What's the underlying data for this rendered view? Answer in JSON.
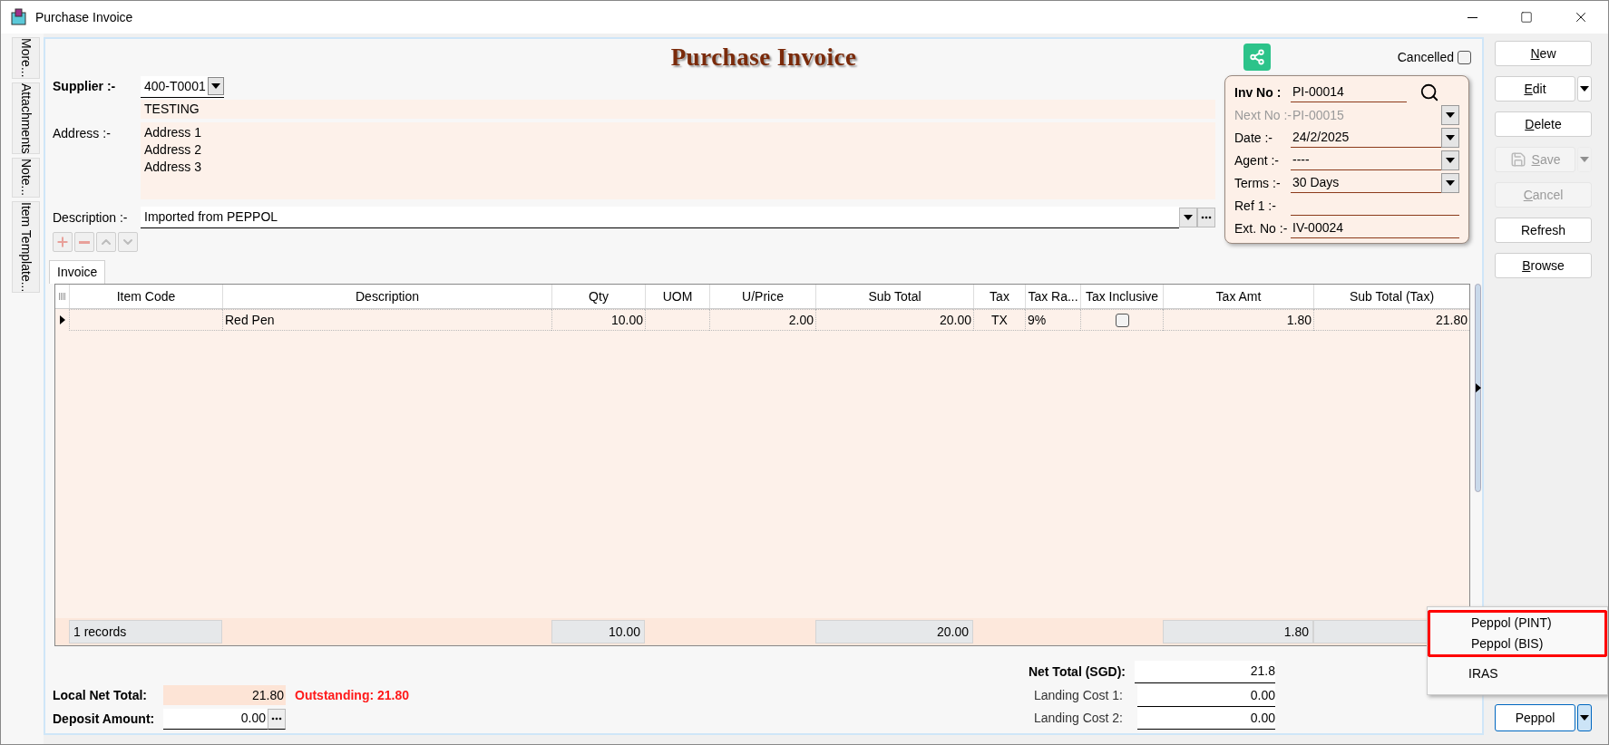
{
  "window": {
    "title": "Purchase Invoice"
  },
  "side_tabs": [
    {
      "label": "More..."
    },
    {
      "label": "Attachments"
    },
    {
      "label": "Note..."
    },
    {
      "label": "Item Template..."
    }
  ],
  "form": {
    "title": "Purchase Invoice",
    "cancelled": {
      "label": "Cancelled",
      "checked": false
    },
    "supplier": {
      "label": "Supplier :-",
      "code": "400-T0001",
      "name": "TESTING"
    },
    "address": {
      "label": "Address :-",
      "lines": [
        "Address 1",
        "Address 2",
        "Address 3"
      ]
    },
    "description": {
      "label": "Description :-",
      "value": "Imported from PEPPOL"
    },
    "header_fields": [
      {
        "label": "Inv No :",
        "value": "PI-00014",
        "kind": "key",
        "disabled": false
      },
      {
        "label": "Next No :-",
        "value": "PI-00015",
        "kind": "dropdown",
        "disabled": true
      },
      {
        "label": "Date :-",
        "value": "24/2/2025",
        "kind": "dropdown",
        "disabled": false
      },
      {
        "label": "Agent :-",
        "value": "----",
        "kind": "dropdown",
        "disabled": false
      },
      {
        "label": "Terms :-",
        "value": "30 Days",
        "kind": "dropdown",
        "disabled": false
      },
      {
        "label": "Ref 1 :-",
        "kind": "plain",
        "disabled": false
      },
      {
        "label": "Ext. No :-",
        "value": "IV-00024",
        "kind": "plain",
        "disabled": false
      }
    ]
  },
  "grid_tabs": [
    {
      "label": "Invoice",
      "selected": true
    }
  ],
  "table": {
    "columns": [
      {
        "label": "Item Code"
      },
      {
        "label": "Description"
      },
      {
        "label": "Qty"
      },
      {
        "label": "UOM"
      },
      {
        "label": "U/Price"
      },
      {
        "label": "Sub Total"
      },
      {
        "label": "Tax"
      },
      {
        "label": "Tax Ra..."
      },
      {
        "label": "Tax Inclusive"
      },
      {
        "label": "Tax Amt"
      },
      {
        "label": "Sub Total (Tax)"
      }
    ],
    "rows": [
      {
        "current": true,
        "cells": [
          {
            "kind": "empty"
          },
          {
            "kind": "text",
            "text": "Red Pen"
          },
          {
            "kind": "text",
            "text": "10.00"
          },
          {
            "kind": "empty"
          },
          {
            "kind": "text",
            "text": "2.00"
          },
          {
            "kind": "text",
            "text": "20.00"
          },
          {
            "kind": "text",
            "text": "TX"
          },
          {
            "kind": "text",
            "text": "9%"
          },
          {
            "kind": "checkbox",
            "checked": false
          },
          {
            "kind": "text",
            "text": "1.80"
          },
          {
            "kind": "text",
            "text": "21.80"
          }
        ]
      }
    ],
    "footer": [
      {
        "text": "1 records",
        "shaded": true
      },
      {
        "shaded": false
      },
      {
        "text": "10.00",
        "shaded": true
      },
      {
        "shaded": false
      },
      {
        "shaded": false
      },
      {
        "text": "20.00",
        "shaded": true
      },
      {
        "shaded": false
      },
      {
        "shaded": false
      },
      {
        "shaded": false
      },
      {
        "text": "1.80",
        "shaded": true
      },
      {
        "shaded": true
      }
    ]
  },
  "totals": {
    "local_net_total": {
      "label": "Local Net Total:",
      "value": "21.80"
    },
    "outstanding": "Outstanding: 21.80",
    "deposit": {
      "label": "Deposit Amount:",
      "value": "0.00"
    },
    "net_total": {
      "label": "Net Total (SGD):",
      "value": "21.8"
    },
    "landing_costs": [
      {
        "label": "Landing Cost 1:",
        "value": "0.00"
      },
      {
        "label": "Landing Cost 2:",
        "value": "0.00"
      }
    ]
  },
  "buttons": [
    {
      "label": "New",
      "underline_first": true,
      "disabled": false,
      "has_menu": false
    },
    {
      "label": "Edit",
      "underline_first": true,
      "disabled": false,
      "has_menu": true
    },
    {
      "label": "Delete",
      "underline_first": true,
      "disabled": false,
      "has_menu": false
    },
    {
      "label": "Save",
      "underline_first": true,
      "disabled": true,
      "has_menu": true
    },
    {
      "label": "Cancel",
      "underline_first": true,
      "disabled": true,
      "has_menu": false
    },
    {
      "label": "Refresh",
      "underline_first": false,
      "disabled": false,
      "has_menu": false
    },
    {
      "label": "Browse",
      "underline_first": true,
      "disabled": false,
      "has_menu": false
    }
  ],
  "export_button": {
    "label": "Peppol"
  },
  "menu": {
    "items": [
      {
        "label": "Peppol (PINT)",
        "boxed": true
      },
      {
        "label": "Peppol (BIS)",
        "boxed": true
      },
      {
        "label": "IRAS",
        "boxed": false
      }
    ]
  }
}
